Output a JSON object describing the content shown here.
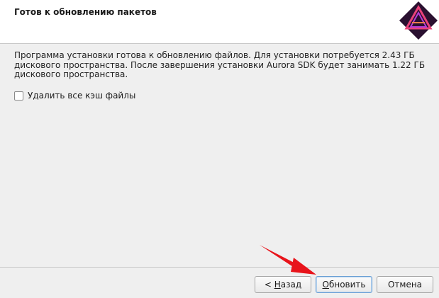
{
  "header": {
    "title": "Готов к обновлению пакетов"
  },
  "main": {
    "description": "Программа установки готова к обновлению файлов. Для установки потребуется 2.43 ГБ дискового пространства. После завершения установки Aurora SDK будет занимать 1.22 ГБ дискового пространства.",
    "clear_cache_label": "Удалить все кэш файлы",
    "clear_cache_checked": false
  },
  "buttons": {
    "back_prefix": "< ",
    "back_mnemonic": "Н",
    "back_rest": "азад",
    "update_mnemonic": "О",
    "update_rest": "бновить",
    "cancel": "Отмена"
  },
  "colors": {
    "arrow": "#e8141b",
    "logo_bg": "#2a1030",
    "logo_accent": "#e9417a"
  },
  "icons": [
    "aurora-logo-icon",
    "red-arrow-annotation"
  ]
}
